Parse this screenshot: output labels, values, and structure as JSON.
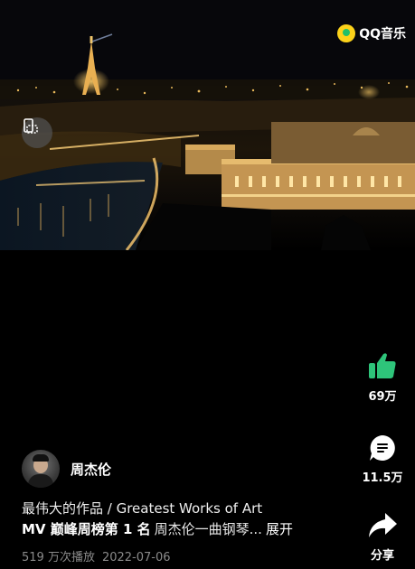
{
  "brand": {
    "name": "QQ音乐",
    "logo_color": "#fcd21a",
    "logo_inner_color": "#1fbf6a"
  },
  "video": {
    "icon": "screen-rotate-icon"
  },
  "actions": {
    "like": {
      "count": "69万",
      "icon": "thumbs-up-icon",
      "color": "#2ec47a"
    },
    "comment": {
      "count": "11.5万",
      "icon": "comment-icon"
    },
    "share": {
      "label": "分享",
      "icon": "share-icon"
    }
  },
  "author": {
    "name": "周杰伦"
  },
  "post": {
    "title": "最伟大的作品 / Greatest Works of Art",
    "tag": "MV 巅峰周榜第 1 名",
    "desc": "周杰伦一曲钢琴...",
    "expand": "展开",
    "plays": "519 万次播放",
    "date": "2022-07-06"
  }
}
